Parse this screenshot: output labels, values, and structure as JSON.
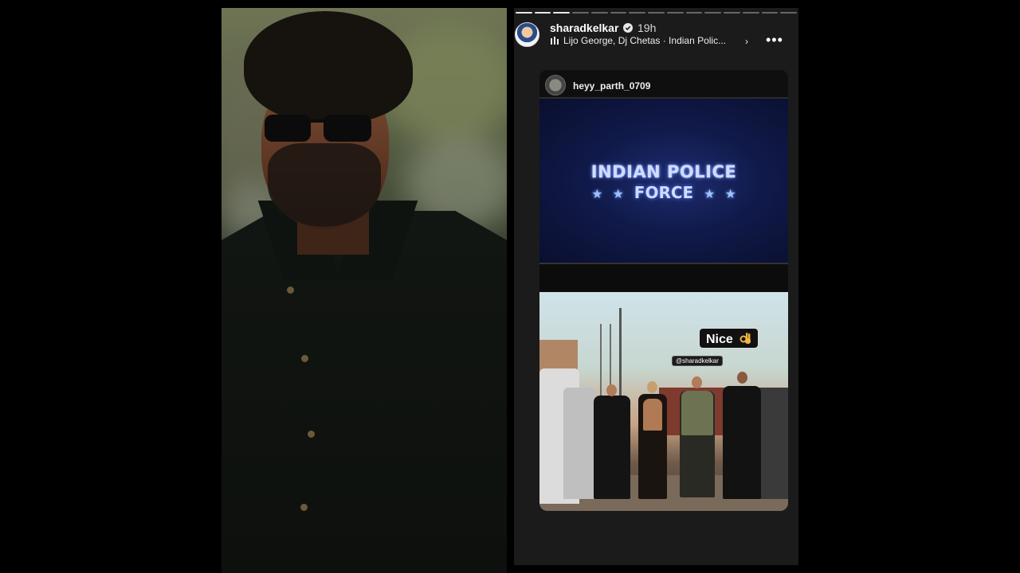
{
  "story": {
    "username": "sharadkelkar",
    "time": "19h",
    "music": "Lijo George, Dj Chetas · Indian Polic...",
    "progress_total": 15,
    "progress_done": 3
  },
  "card": {
    "username": "heyy_parth_0709",
    "banner_title_line1": "INDIAN POLICE",
    "banner_title_line2": "FORCE",
    "sticker": "Nice",
    "mention": "@sharadkelkar"
  },
  "icons": {
    "verified": "verified-badge-icon",
    "music": "music-bars-icon",
    "more": "more-horizontal-icon",
    "ok": "ok-hand-icon"
  },
  "colors": {
    "verified": "#3897f0",
    "banner_glow": "#5b7dff"
  }
}
